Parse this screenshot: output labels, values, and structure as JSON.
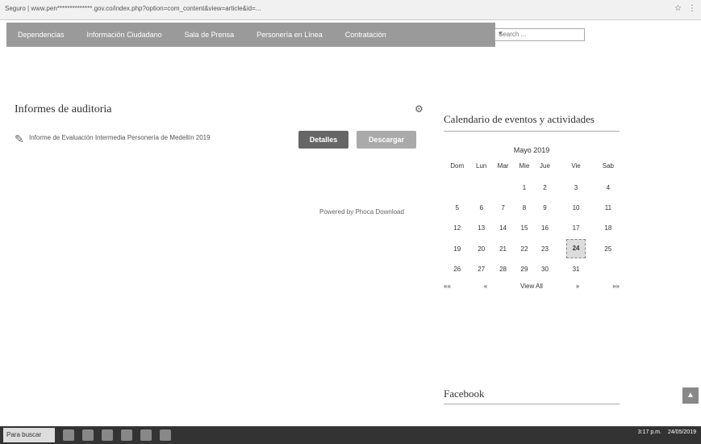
{
  "browser": {
    "address": "Seguro | www.pen**************.gov.co/index.php?option=com_content&view=article&id=...",
    "icons": [
      "star-icon",
      "menu-icon"
    ]
  },
  "nav": {
    "items": [
      "Dependencias",
      "Información Ciudadano",
      "Sala de Prensa",
      "Personería en Línea",
      "Contratación"
    ]
  },
  "search": {
    "placeholder": "Search ..."
  },
  "main": {
    "title": "Informes de auditoria",
    "document": "Informe de Evaluación Intermedia Personería de Medellín 2019",
    "details_label": "Detalles",
    "download_label": "Descargar",
    "powered": "Powered by Phoca Download"
  },
  "calendar": {
    "title": "Calendario de eventos y actividades",
    "month": "Mayo 2019",
    "weekdays": [
      "Dom",
      "Lun",
      "Mar",
      "Mie",
      "Jue",
      "Vie",
      "Sab"
    ],
    "weeks": [
      [
        "",
        "",
        "",
        "1",
        "2",
        "3",
        "4"
      ],
      [
        "5",
        "6",
        "7",
        "8",
        "9",
        "10",
        "11"
      ],
      [
        "12",
        "13",
        "14",
        "15",
        "16",
        "17",
        "18"
      ],
      [
        "19",
        "20",
        "21",
        "22",
        "23",
        "24",
        "25"
      ],
      [
        "26",
        "27",
        "28",
        "29",
        "30",
        "31",
        ""
      ]
    ],
    "today": "24",
    "nav": {
      "prev_year": "««",
      "prev": "«",
      "view_all": "View All",
      "next": "»",
      "next_year": "»»"
    }
  },
  "facebook": {
    "title": "Facebook"
  },
  "taskbar": {
    "search_label": "Para buscar",
    "time": "3:17 p.m.",
    "date": "24/05/2019"
  }
}
